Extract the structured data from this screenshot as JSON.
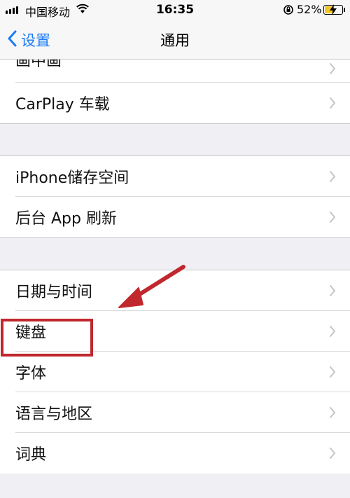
{
  "status_bar": {
    "carrier": "中国移动",
    "time": "16:35",
    "battery_percent": "52%",
    "icons": [
      "signal-icon",
      "wifi-icon",
      "rotation-lock-icon",
      "battery-icon",
      "charging-bolt-icon"
    ],
    "battery_color": "#f3c623",
    "battery_level": 0.52
  },
  "nav": {
    "back_label": "设置",
    "title": "通用",
    "accent_color": "#1a7cf5"
  },
  "list": {
    "partial_top": "画中画",
    "group1": [
      "CarPlay 车载"
    ],
    "group2": [
      "iPhone储存空间",
      "后台 App 刷新"
    ],
    "group3": [
      "日期与时间",
      "键盘",
      "字体",
      "语言与地区",
      "词典"
    ]
  },
  "annotation": {
    "highlight_color": "#c0282d",
    "highlighted_item": "键盘"
  }
}
